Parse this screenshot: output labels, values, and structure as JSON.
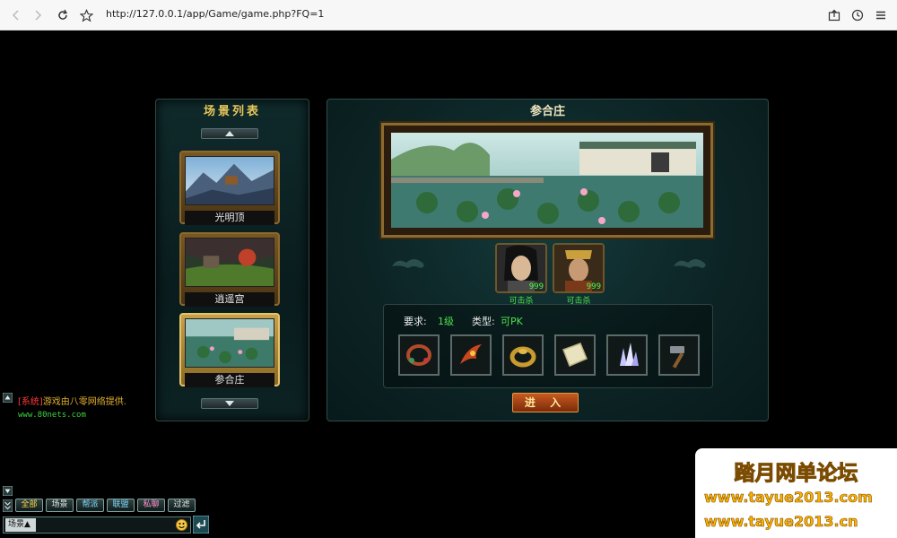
{
  "browser": {
    "url": "http://127.0.0.1/app/Game/game.php?FQ=1",
    "icons": [
      "back-icon",
      "forward-icon",
      "reload-icon",
      "star-icon",
      "share-icon",
      "history-icon",
      "menu-icon"
    ]
  },
  "scene_list": {
    "title": "场景列表",
    "items": [
      {
        "label": "光明顶"
      },
      {
        "label": "逍遥宫"
      },
      {
        "label": "参合庄"
      }
    ],
    "selected": "参合庄"
  },
  "scene_detail": {
    "title": "参合庄",
    "npcs": [
      {
        "level": "999",
        "tag": "可击杀"
      },
      {
        "level": "999",
        "tag": "可击杀"
      }
    ],
    "requirement_label": "要求:",
    "requirement_value": "1级",
    "type_label": "类型:",
    "type_value": "可PK",
    "items": [
      "bracelet-icon",
      "claw-icon",
      "ring-icon",
      "scroll-icon",
      "crystal-icon",
      "hammer-icon"
    ],
    "enter_label": "进 入"
  },
  "chat": {
    "system_tag": "[系统]",
    "system_msg": "游戏由八零网络提供.",
    "site": "www.80nets.com",
    "tabs": [
      "全部",
      "场景",
      "帮派",
      "联盟",
      "私聊",
      "过滤"
    ],
    "scope": "场景▲"
  },
  "watermark": {
    "title": "踏月网单论坛",
    "url1": "www.tayue2013.com",
    "url2": "www.tayue2013.cn"
  },
  "colors": {
    "gold": "#e8c65a",
    "green": "#4ce24c",
    "system_red": "#ff3b3b"
  }
}
